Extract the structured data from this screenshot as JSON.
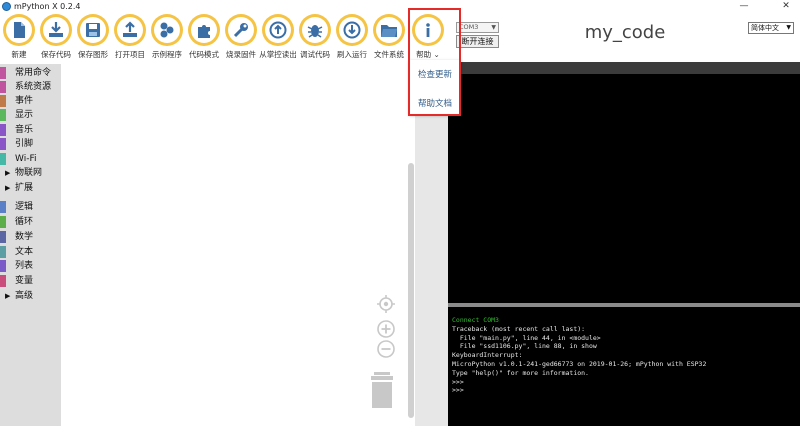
{
  "window": {
    "title": "mPython X 0.2.4",
    "minimize": "—",
    "close": "✕"
  },
  "toolbar": {
    "items": [
      {
        "label": "新建",
        "icon": "new-file-icon"
      },
      {
        "label": "保存代码",
        "icon": "save-code-icon"
      },
      {
        "label": "保存图形",
        "icon": "save-graphic-icon"
      },
      {
        "label": "打开项目",
        "icon": "open-project-icon"
      },
      {
        "label": "示例程序",
        "icon": "example-programs-icon"
      },
      {
        "label": "代码模式",
        "icon": "code-mode-icon"
      },
      {
        "label": "烧录固件",
        "icon": "flash-firmware-icon"
      },
      {
        "label": "从掌控读出",
        "icon": "read-from-board-icon"
      },
      {
        "label": "调试代码",
        "icon": "debug-code-icon"
      },
      {
        "label": "刷入运行",
        "icon": "flash-run-icon"
      },
      {
        "label": "文件系统",
        "icon": "file-system-icon"
      },
      {
        "label": "帮助 ⌄",
        "icon": "help-info-icon"
      }
    ],
    "accent_color": "#f6c445"
  },
  "connection": {
    "port_value": "COM3",
    "connect_button": "断开连接"
  },
  "project_title": "my_code",
  "language_select": "简体中文",
  "help_menu": {
    "items": [
      "检查更新",
      "帮助文档"
    ]
  },
  "categories": [
    {
      "label": "常用命令",
      "color": "#c1549f"
    },
    {
      "label": "系统资源",
      "color": "#c1549f"
    },
    {
      "label": "事件",
      "color": "#c07a4a"
    },
    {
      "label": "显示",
      "color": "#5cb85c"
    },
    {
      "label": "音乐",
      "color": "#8a55c7"
    },
    {
      "label": "引脚",
      "color": "#8a55c7"
    },
    {
      "label": "Wi-Fi",
      "color": "#46b8a8"
    },
    {
      "label": "物联网",
      "color": ""
    },
    {
      "label": "扩展",
      "color": ""
    },
    {
      "label": "逻辑",
      "color": "#5b80c7"
    },
    {
      "label": "循环",
      "color": "#5cae4a"
    },
    {
      "label": "数学",
      "color": "#5b67a5"
    },
    {
      "label": "文本",
      "color": "#5b9fa5"
    },
    {
      "label": "列表",
      "color": "#7a5bc7"
    },
    {
      "label": "变量",
      "color": "#c94c7a"
    },
    {
      "label": "高级",
      "color": ""
    }
  ],
  "terminal": {
    "lines": [
      "Connect COM3",
      "Traceback (most recent call last):",
      "  File \"main.py\", line 44, in <module>",
      "  File \"ssd1106.py\", line 88, in show",
      "KeyboardInterrupt:",
      "MicroPython v1.0.1-241-ged66773 on 2019-01-26; mPython with ESP32",
      "Type \"help()\" for more information.",
      ">>>",
      ">>>"
    ]
  }
}
